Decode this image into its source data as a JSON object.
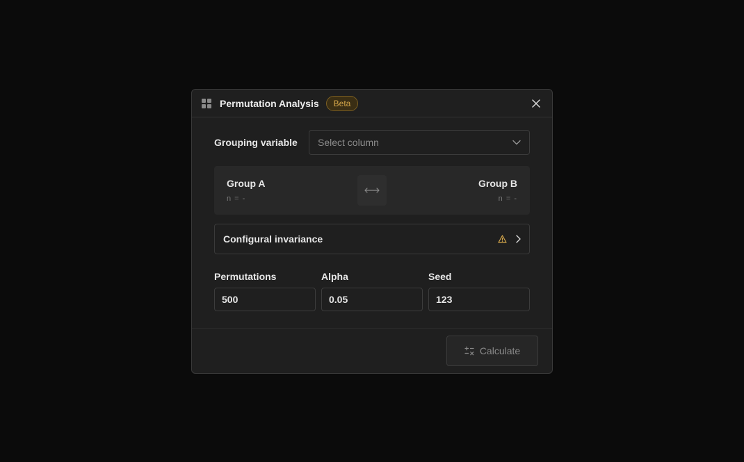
{
  "dialog": {
    "title": "Permutation Analysis",
    "badge": "Beta",
    "app_icon": "grid-icon",
    "close_icon": "close-icon"
  },
  "grouping": {
    "label": "Grouping variable",
    "placeholder": "Select column",
    "dropdown_icon": "chevron-down-icon"
  },
  "groups": {
    "a": {
      "name": "Group A",
      "n": "n = -"
    },
    "b": {
      "name": "Group B",
      "n": "n = -"
    },
    "swap_icon": "swap-arrows-icon"
  },
  "invariance": {
    "label": "Configural invariance",
    "warning_icon": "warning-icon",
    "chevron_icon": "chevron-right-icon",
    "warning_color": "#d4a64a"
  },
  "params": {
    "permutations": {
      "label": "Permutations",
      "value": "500"
    },
    "alpha": {
      "label": "Alpha",
      "value": "0.05"
    },
    "seed": {
      "label": "Seed",
      "value": "123"
    }
  },
  "footer": {
    "calculate_label": "Calculate",
    "calculate_icon": "calculator-icon"
  }
}
